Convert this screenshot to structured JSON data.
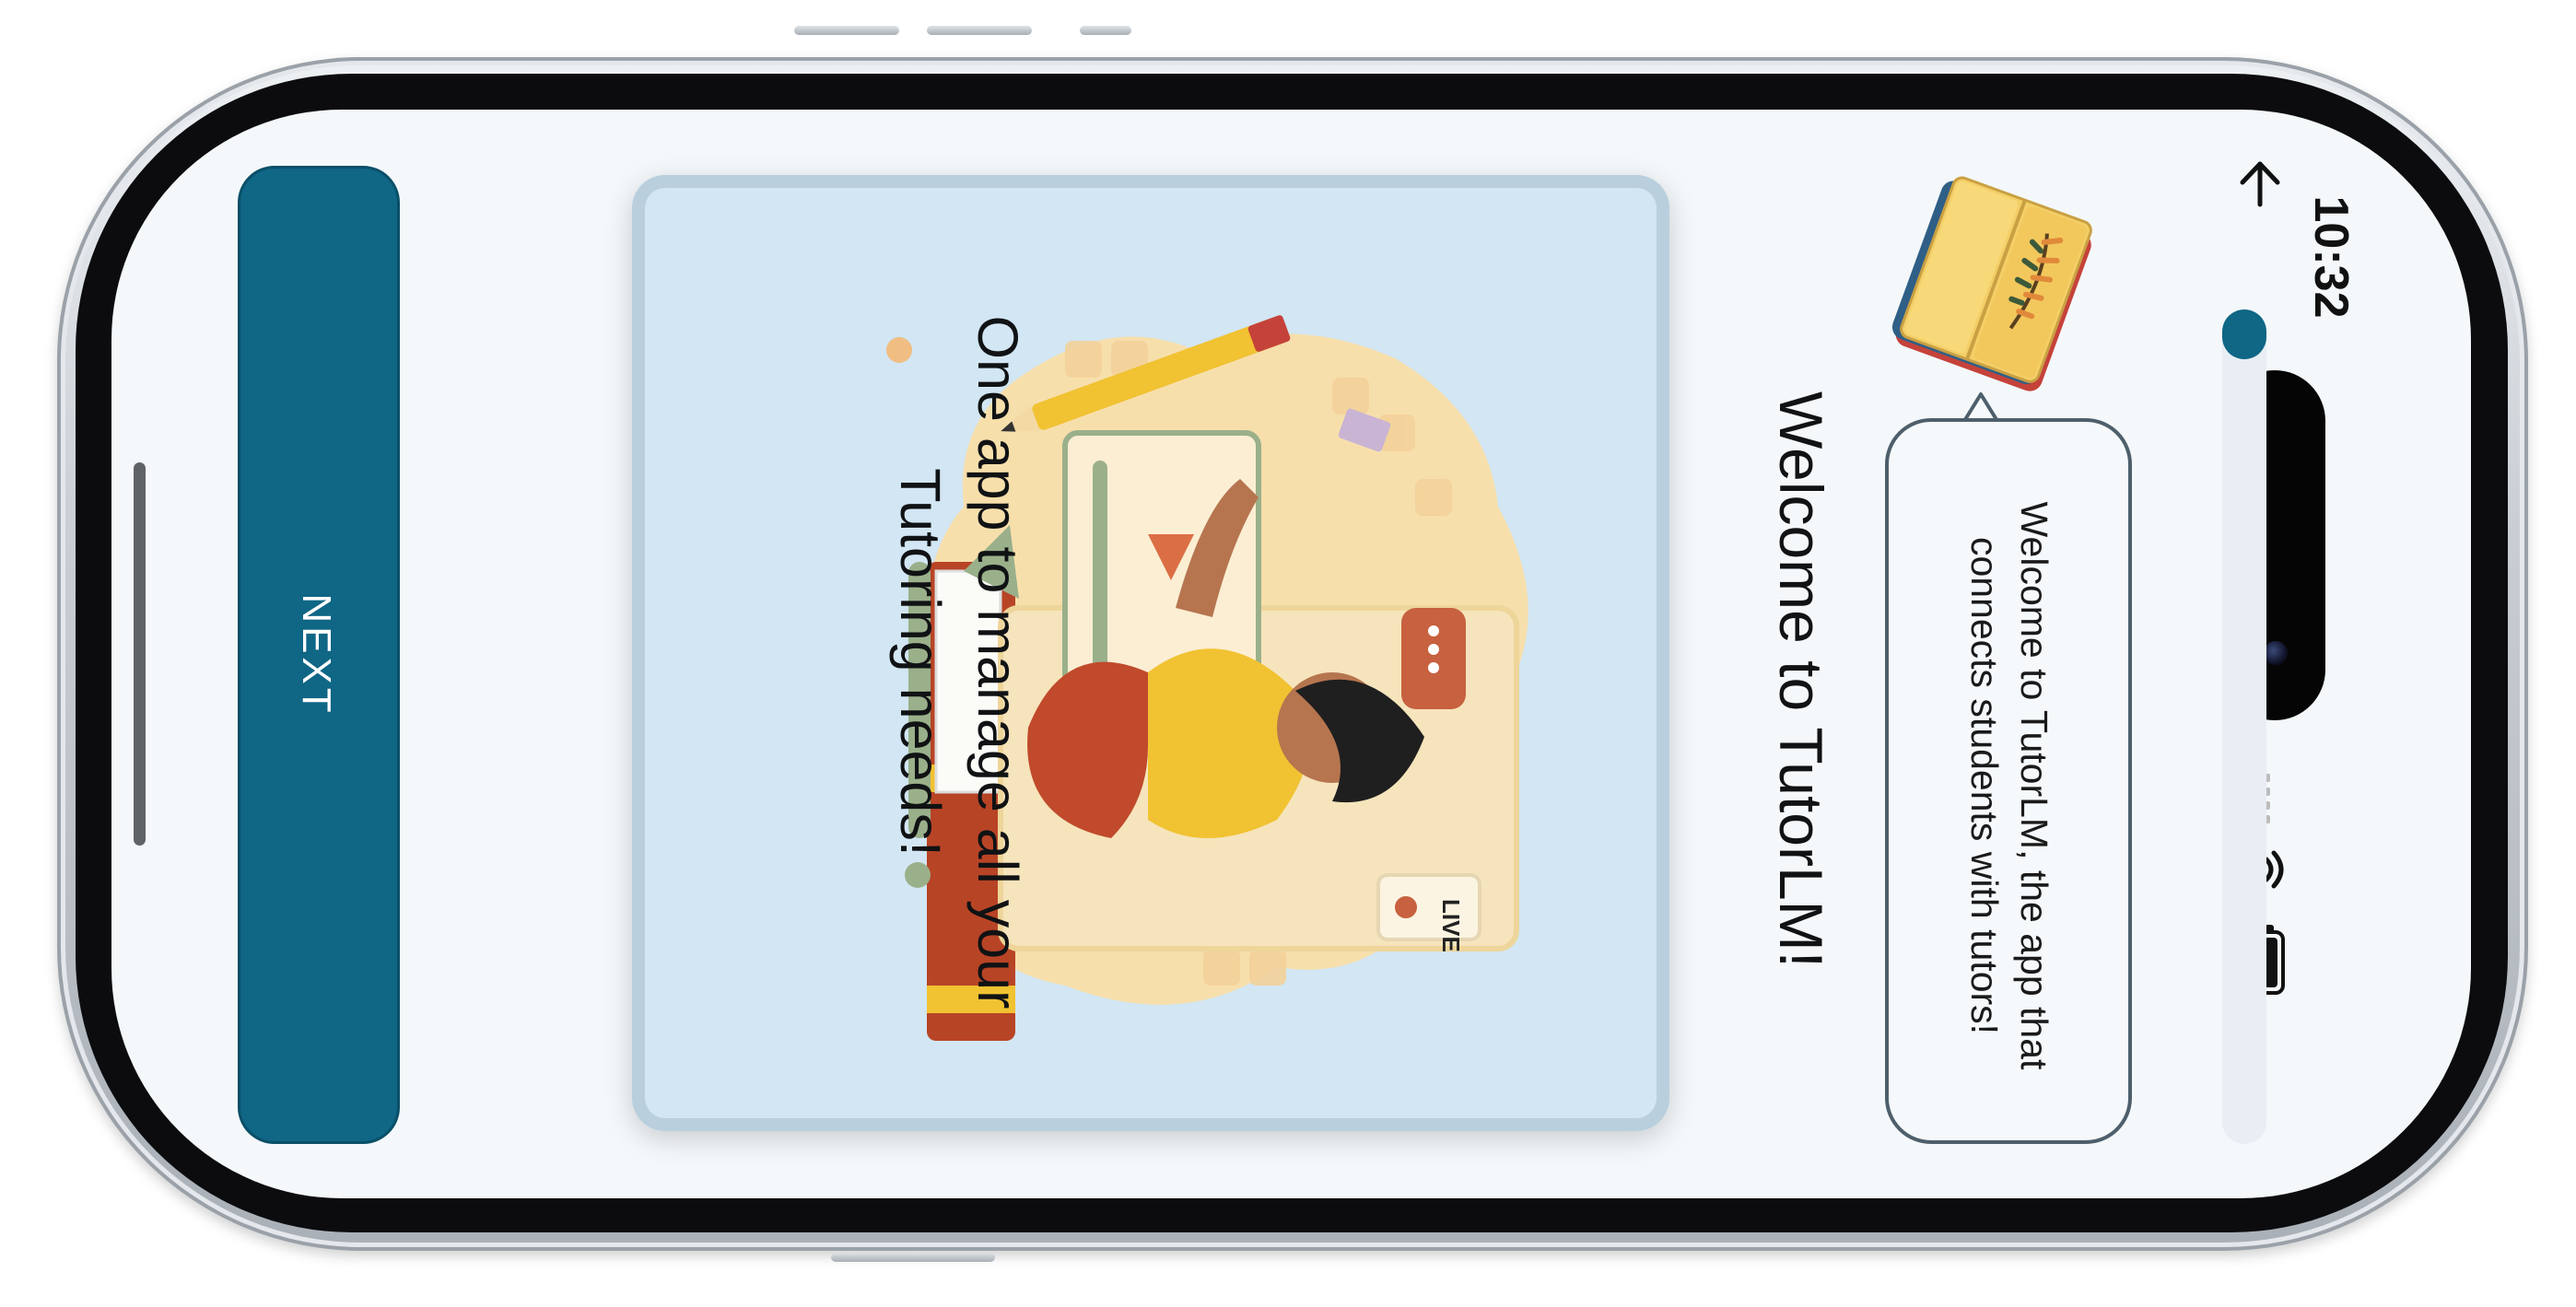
{
  "status_bar": {
    "time": "10:32",
    "icons": [
      "signal-icon",
      "wifi-icon",
      "battery-icon"
    ]
  },
  "header": {
    "back_icon": "arrow-up-icon",
    "progress_fraction": 0.06,
    "mascot_icon": "open-book-icon"
  },
  "speech_bubble": {
    "text": "Welcome to TutorLM, the app that connects students with tutors!"
  },
  "main": {
    "title": "Welcome to TutorLM!",
    "caption": "One app to manage all your Tutoring needs!",
    "illustration": {
      "badge_text": "LIVE"
    }
  },
  "footer": {
    "next_label": "NEXT"
  },
  "colors": {
    "accent": "#0f6685",
    "screen_bg": "#f4f8fb",
    "card_bg": "#d2e6f3",
    "bubble_border": "#4e5f6c"
  }
}
